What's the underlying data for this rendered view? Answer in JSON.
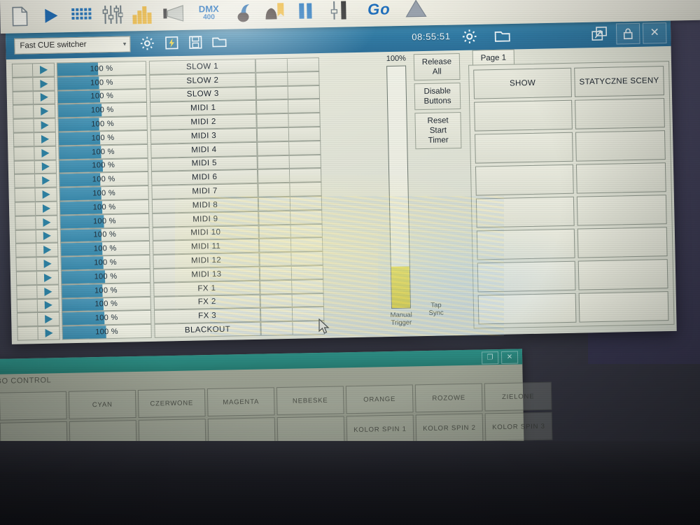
{
  "window": {
    "title": "Fast CUE switcher",
    "clock": "08:55:51",
    "combo_value": "Fast CUE switcher",
    "icons": {
      "chevron": "▾",
      "gear": "gear-icon",
      "lightning_save": "lightning-save-icon",
      "floppy": "save-icon",
      "open": "open-folder-icon",
      "restore": "restore-window-icon",
      "lock": "🔒",
      "close": "✕"
    }
  },
  "toolbar": {
    "items": [
      {
        "name": "new-file-icon",
        "label": ""
      },
      {
        "name": "play-icon",
        "label": ""
      },
      {
        "name": "grid-icon",
        "label": ""
      },
      {
        "name": "faders-icon",
        "label": ""
      },
      {
        "name": "bars-icon",
        "label": ""
      },
      {
        "name": "beam-icon",
        "label": ""
      },
      {
        "name": "dmx-icon",
        "label": "DMX",
        "sub": "400"
      },
      {
        "name": "moving-head-icon",
        "label": ""
      },
      {
        "name": "scanner-icon",
        "label": ""
      },
      {
        "name": "pause-icon",
        "label": ""
      },
      {
        "name": "single-fader-icon",
        "label": ""
      },
      {
        "name": "go-button",
        "label": "Go"
      },
      {
        "name": "warning-triangle-icon",
        "label": ""
      }
    ]
  },
  "cue_table": {
    "percent_label": "100 %",
    "fader_percent": 46,
    "rows": [
      {
        "name": "SLOW 1",
        "percent": "100 %"
      },
      {
        "name": "SLOW 2",
        "percent": "100 %"
      },
      {
        "name": "SLOW 3",
        "percent": "100 %"
      },
      {
        "name": "MIDI 1",
        "percent": "100 %"
      },
      {
        "name": "MIDI 2",
        "percent": "100 %"
      },
      {
        "name": "MIDI 3",
        "percent": "100 %"
      },
      {
        "name": "MIDI 4",
        "percent": "100 %"
      },
      {
        "name": "MIDI 5",
        "percent": "100 %"
      },
      {
        "name": "MIDI 6",
        "percent": "100 %"
      },
      {
        "name": "MIDI 7",
        "percent": "100 %"
      },
      {
        "name": "MIDI 8",
        "percent": "100 %"
      },
      {
        "name": "MIDI 9",
        "percent": "100 %"
      },
      {
        "name": "MIDI 10",
        "percent": "100 %"
      },
      {
        "name": "MIDI 11",
        "percent": "100 %"
      },
      {
        "name": "MIDI 12",
        "percent": "100 %"
      },
      {
        "name": "MIDI 13",
        "percent": "100 %"
      },
      {
        "name": "FX 1",
        "percent": "100 %"
      },
      {
        "name": "FX 2",
        "percent": "100 %"
      },
      {
        "name": "FX 3",
        "percent": "100 %"
      },
      {
        "name": "BLACKOUT",
        "percent": "100 %"
      }
    ]
  },
  "master": {
    "label": "100%",
    "level_percent": 17,
    "caption_line1": "Manual",
    "caption_line2": "Trigger"
  },
  "tap_sync": {
    "line1": "Tap",
    "line2": "Sync"
  },
  "controls": {
    "release_all_line1": "Release",
    "release_all_line2": "All",
    "disable_line1": "Disable",
    "disable_line2": "Buttons",
    "reset_line1": "Reset",
    "reset_line2": "Start",
    "reset_line3": "Timer"
  },
  "page_panel": {
    "tab_label": "Page 1",
    "buttons": [
      "SHOW",
      "STATYCZNE SCENY",
      "",
      "",
      "",
      "",
      "",
      "",
      "",
      "",
      "",
      "",
      "",
      "",
      "",
      ""
    ]
  },
  "background_window": {
    "menu": "BO  CONTROL",
    "restore_label": "❐",
    "close_label": "✕",
    "buttons_row1": [
      "",
      "CYAN",
      "CZERWONE",
      "MAGENTA",
      "NEBESKE",
      "ORANGE",
      "ROZOWE",
      "ZIELONE"
    ],
    "buttons_row2": [
      "",
      "",
      "",
      "",
      "",
      "KOLOR SPIN 1",
      "KOLOR SPIN 2",
      "KOLOR SPIN 3"
    ]
  },
  "colors": {
    "title_bar": "#317aa3",
    "fader_blue": "#3a89ab",
    "master_yellow": "#d6c93f",
    "go_blue": "#1f6fbd",
    "bg_window_title": "#25786f"
  }
}
